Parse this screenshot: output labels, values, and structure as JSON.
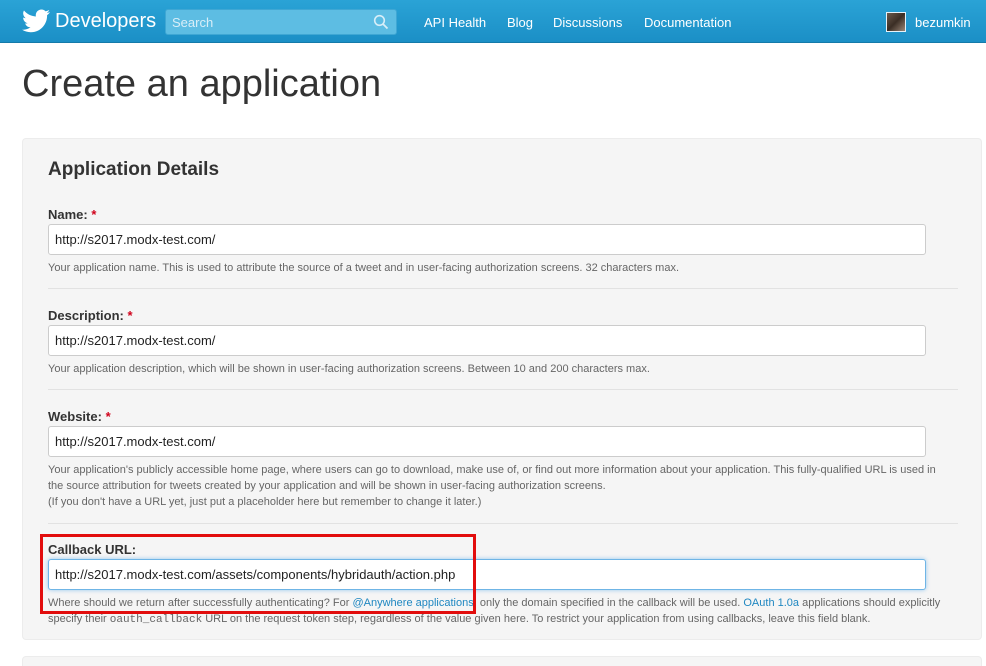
{
  "header": {
    "brand": "Developers",
    "search_placeholder": "Search",
    "nav": [
      "API Health",
      "Blog",
      "Discussions",
      "Documentation"
    ],
    "username": "bezumkin"
  },
  "page": {
    "title": "Create an application",
    "section_title": "Application Details",
    "required_mark": "*",
    "fields": {
      "name": {
        "label": "Name:",
        "value": "http://s2017.modx-test.com/",
        "help": "Your application name. This is used to attribute the source of a tweet and in user-facing authorization screens. 32 characters max."
      },
      "description": {
        "label": "Description:",
        "value": "http://s2017.modx-test.com/",
        "help": "Your application description, which will be shown in user-facing authorization screens. Between 10 and 200 characters max."
      },
      "website": {
        "label": "Website:",
        "value": "http://s2017.modx-test.com/",
        "help": "Your application's publicly accessible home page, where users can go to download, make use of, or find out more information about your application. This fully-qualified URL is used in the source attribution for tweets created by your application and will be shown in user-facing authorization screens.",
        "help2": "(If you don't have a URL yet, just put a placeholder here but remember to change it later.)"
      },
      "callback": {
        "label": "Callback URL:",
        "value": "http://s2017.modx-test.com/assets/components/hybridauth/action.php",
        "help_a": "Where should we return after successfully authenticating? For ",
        "link1": "@Anywhere applications",
        "help_b": ", only the domain specified in the callback will be used. ",
        "link2": "OAuth 1.0a",
        "help_c": " applications should explicitly specify their ",
        "code": "oauth_callback",
        "help_d": " URL on the request token step, regardless of the value given here. To restrict your application from using callbacks, leave this field blank."
      }
    }
  },
  "colors": {
    "topbar": "#1b8fc6",
    "link": "#1f87c1",
    "required": "#d0021b",
    "highlight_box": "#e20d0d"
  },
  "icons": {
    "logo": "twitter-bird-icon",
    "search": "search-icon"
  }
}
